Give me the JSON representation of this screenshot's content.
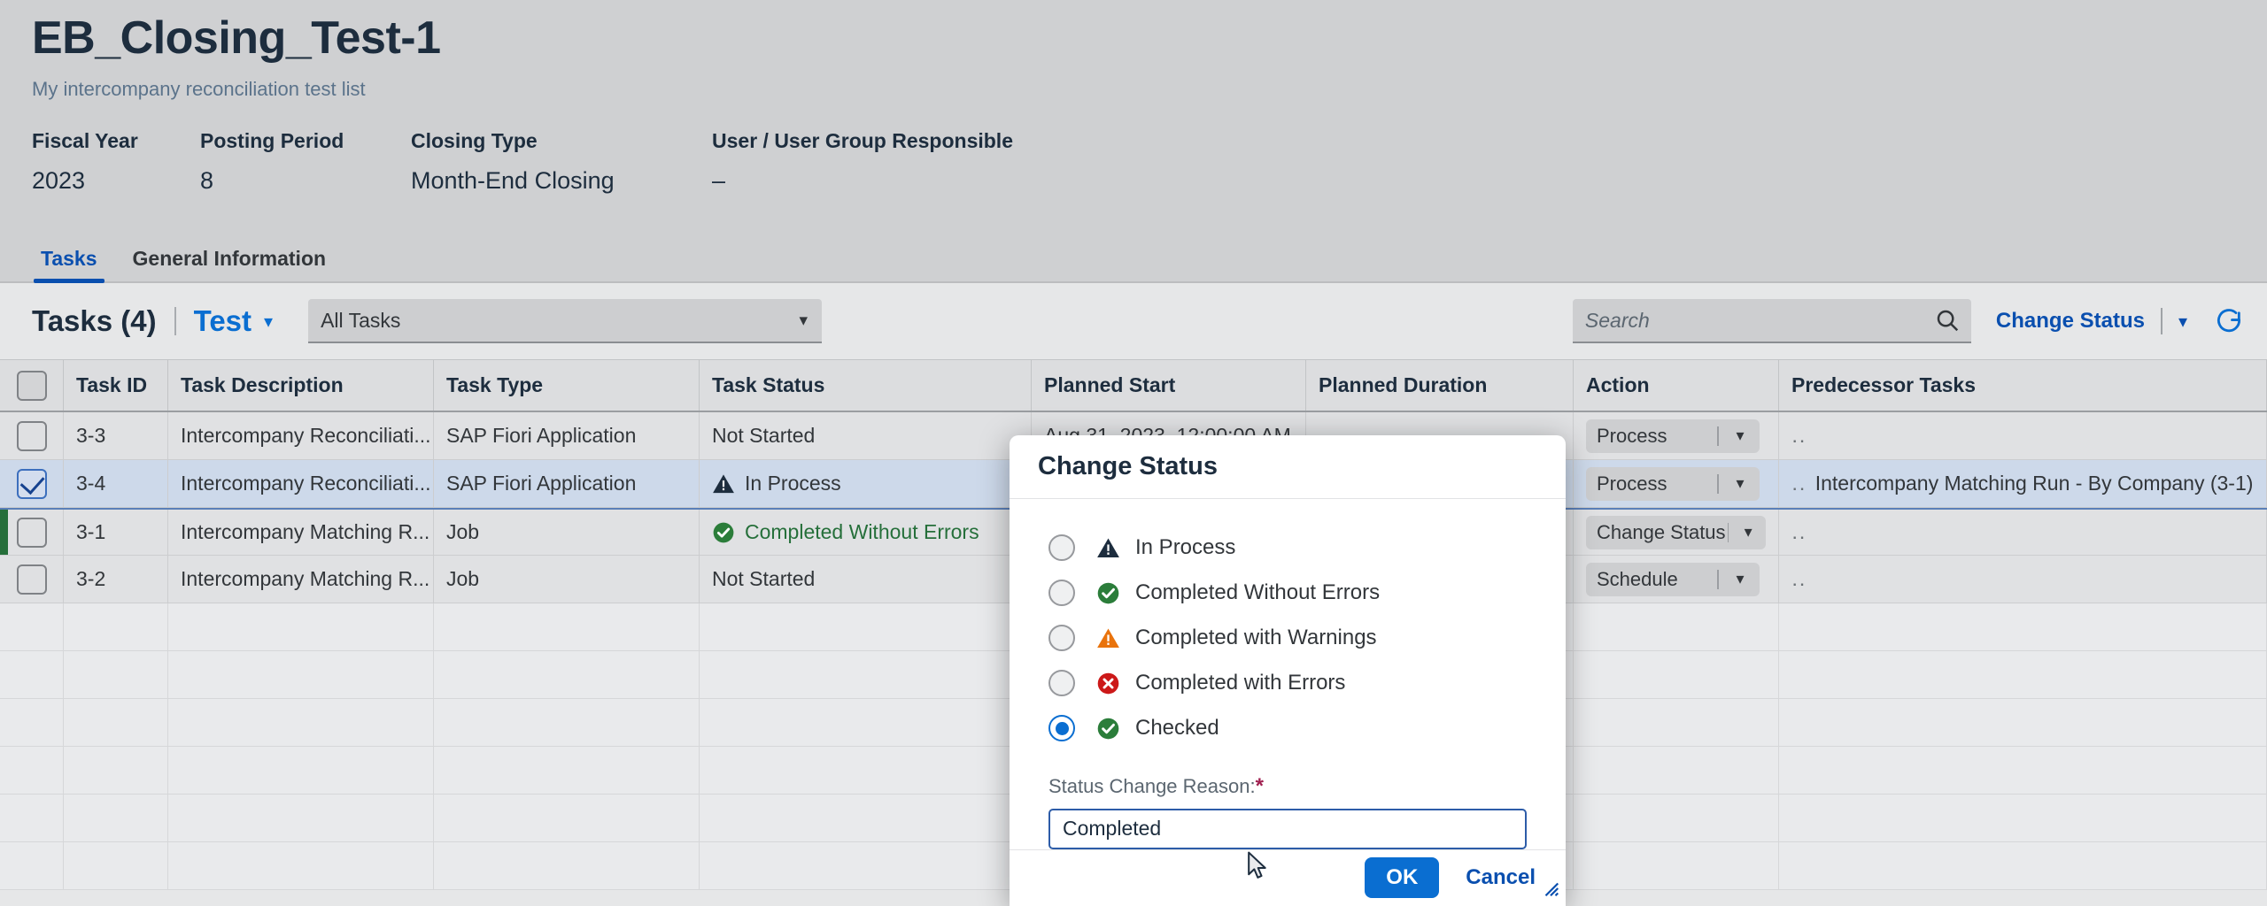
{
  "header": {
    "title": "EB_Closing_Test-1",
    "subtitle": "My intercompany reconciliation test list",
    "fields": [
      {
        "label": "Fiscal Year",
        "value": "2023"
      },
      {
        "label": "Posting Period",
        "value": "8"
      },
      {
        "label": "Closing Type",
        "value": "Month-End Closing"
      },
      {
        "label": "User / User Group Responsible",
        "value": "–"
      }
    ]
  },
  "tabs": [
    {
      "label": "Tasks",
      "active": true
    },
    {
      "label": "General Information",
      "active": false
    }
  ],
  "toolbar": {
    "title": "Tasks (4)",
    "variant": "Test",
    "variant_chevron": "chevron-down-icon",
    "filter_value": "All Tasks",
    "search_placeholder": "Search",
    "search_value": "",
    "search_icon": "search-icon",
    "change_status_label": "Change Status",
    "menu_chevron": "chevron-down-icon",
    "refresh_icon": "refresh-icon"
  },
  "table": {
    "columns": [
      "Task ID",
      "Task Description",
      "Task Type",
      "Task Status",
      "Planned Start",
      "Planned Duration",
      "Action",
      "Predecessor Tasks"
    ],
    "rows": [
      {
        "checked": false,
        "marked": false,
        "id": "3-3",
        "description": "Intercompany Reconciliati...",
        "type": "SAP Fiori Application",
        "status": "Not Started",
        "status_icon": "",
        "planned_start": "Aug 31, 2023, 12:00:00 AM",
        "planned_duration": "",
        "action": "Process",
        "action_chevron": "chevron-down-icon",
        "predecessor": ""
      },
      {
        "checked": true,
        "marked": false,
        "id": "3-4",
        "description": "Intercompany Reconciliati...",
        "type": "SAP Fiori Application",
        "status": "In Process",
        "status_icon": "warning-dark-icon",
        "planned_start": "",
        "planned_duration": "",
        "action": "Process",
        "action_chevron": "chevron-down-icon",
        "predecessor": "Intercompany Matching Run - By Company (3-1)"
      },
      {
        "checked": false,
        "marked": true,
        "id": "3-1",
        "description": "Intercompany Matching R...",
        "type": "Job",
        "status": "Completed Without Errors",
        "status_icon": "success-icon",
        "planned_start": "",
        "planned_duration": "",
        "action": "Change Status",
        "action_chevron": "chevron-down-icon",
        "predecessor": ""
      },
      {
        "checked": false,
        "marked": false,
        "id": "3-2",
        "description": "Intercompany Matching R...",
        "type": "Job",
        "status": "Not Started",
        "status_icon": "",
        "planned_start": "",
        "planned_duration": "",
        "action": "Schedule",
        "action_chevron": "chevron-down-icon",
        "predecessor": ""
      }
    ]
  },
  "dialog": {
    "title": "Change Status",
    "options": [
      {
        "label": "In Process",
        "icon": "warning-dark-icon",
        "selected": false
      },
      {
        "label": "Completed Without Errors",
        "icon": "success-icon",
        "selected": false
      },
      {
        "label": "Completed with Warnings",
        "icon": "warning-orange-icon",
        "selected": false
      },
      {
        "label": "Completed with Errors",
        "icon": "error-icon",
        "selected": false
      },
      {
        "label": "Checked",
        "icon": "success-icon",
        "selected": true
      }
    ],
    "reason_label": "Status Change Reason:",
    "reason_required_mark": "*",
    "reason_value": "Completed",
    "ok_label": "OK",
    "cancel_label": "Cancel"
  },
  "colors": {
    "accent_blue": "#0a6ed1",
    "link_blue": "#0a4faf",
    "success_green": "#256f3a",
    "warning_orange": "#e9730c",
    "error_red": "#cc1919",
    "page_bg": "#cfd0d2",
    "content_bg": "#e6e7e8"
  }
}
